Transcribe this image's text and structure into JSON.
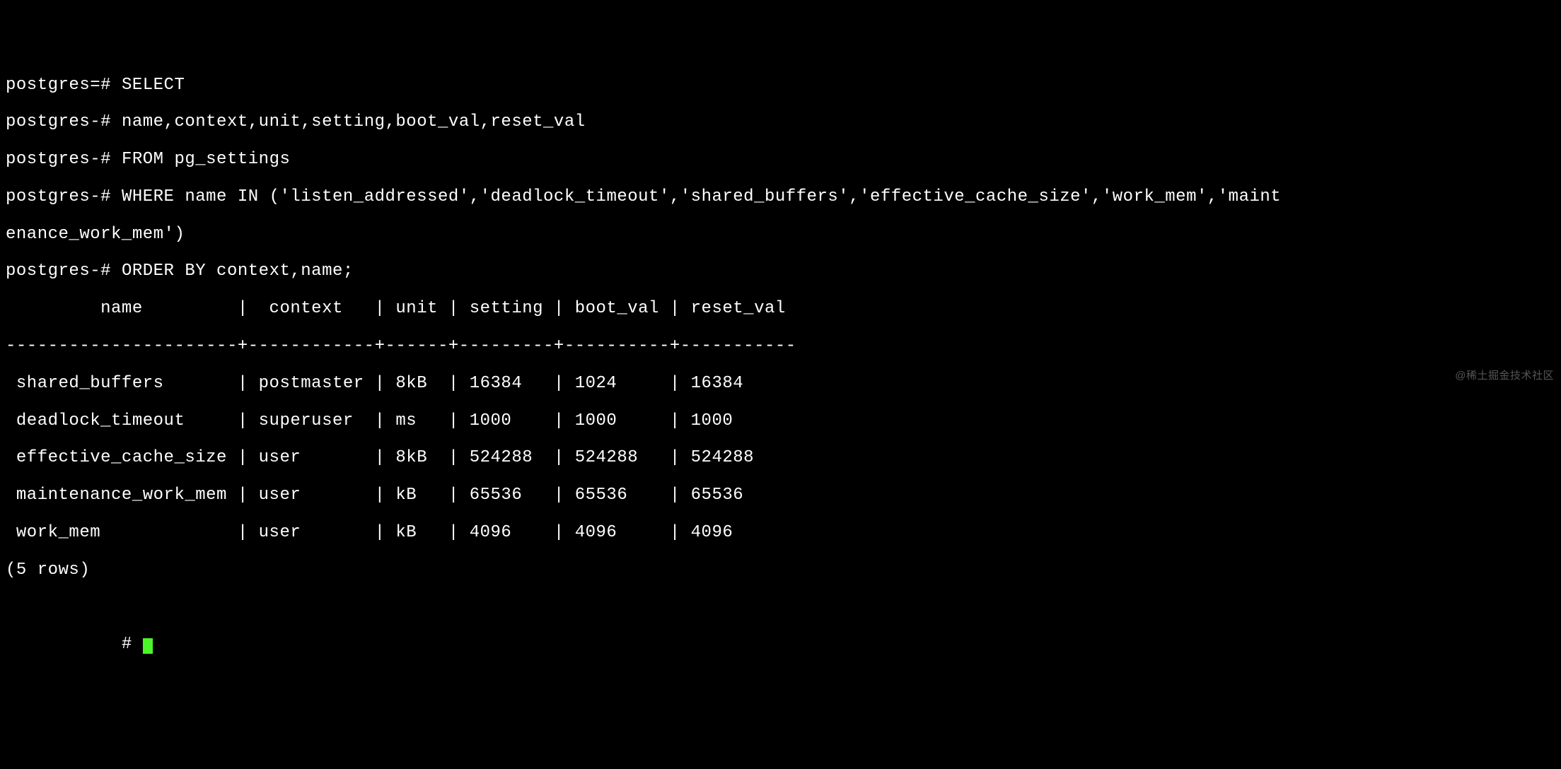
{
  "query": {
    "line1_prompt": "postgres=# ",
    "line1_text": "SELECT",
    "line2_prompt": "postgres-# ",
    "line2_text": "name,context,unit,setting,boot_val,reset_val",
    "line3_prompt": "postgres-# ",
    "line3_text": "FROM pg_settings",
    "line4_prompt": "postgres-# ",
    "line4_text": "WHERE name IN ('listen_addressed','deadlock_timeout','shared_buffers','effective_cache_size','work_mem','maint",
    "line5_text": "enance_work_mem')",
    "line6_prompt": "postgres-# ",
    "line6_text": "ORDER BY context,name;"
  },
  "result": {
    "header": "         name         |  context   | unit | setting | boot_val | reset_val",
    "separator": "----------------------+------------+------+---------+----------+-----------",
    "rows": [
      " shared_buffers       | postmaster | 8kB  | 16384   | 1024     | 16384",
      " deadlock_timeout     | superuser  | ms   | 1000    | 1000     | 1000",
      " effective_cache_size | user       | 8kB  | 524288  | 524288   | 524288",
      " maintenance_work_mem | user       | kB   | 65536   | 65536    | 65536",
      " work_mem             | user       | kB   | 4096    | 4096     | 4096"
    ],
    "footer": "(5 rows)"
  },
  "next_prompt_prefix": "           # ",
  "watermark": "@稀土掘金技术社区",
  "chart_data": {
    "type": "table",
    "title": "pg_settings query result",
    "columns": [
      "name",
      "context",
      "unit",
      "setting",
      "boot_val",
      "reset_val"
    ],
    "data": [
      {
        "name": "shared_buffers",
        "context": "postmaster",
        "unit": "8kB",
        "setting": 16384,
        "boot_val": 1024,
        "reset_val": 16384
      },
      {
        "name": "deadlock_timeout",
        "context": "superuser",
        "unit": "ms",
        "setting": 1000,
        "boot_val": 1000,
        "reset_val": 1000
      },
      {
        "name": "effective_cache_size",
        "context": "user",
        "unit": "8kB",
        "setting": 524288,
        "boot_val": 524288,
        "reset_val": 524288
      },
      {
        "name": "maintenance_work_mem",
        "context": "user",
        "unit": "kB",
        "setting": 65536,
        "boot_val": 65536,
        "reset_val": 65536
      },
      {
        "name": "work_mem",
        "context": "user",
        "unit": "kB",
        "setting": 4096,
        "boot_val": 4096,
        "reset_val": 4096
      }
    ]
  }
}
